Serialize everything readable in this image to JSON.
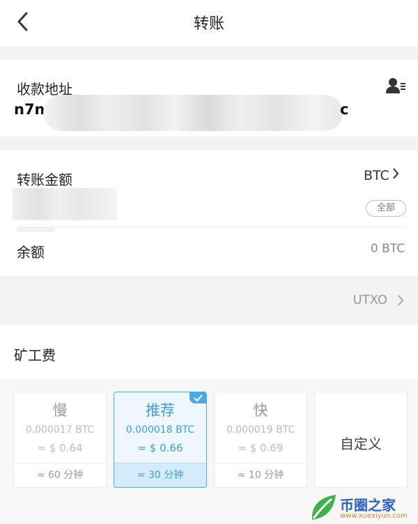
{
  "header": {
    "title": "转账",
    "back_icon": "chevron-left-icon"
  },
  "address": {
    "label": "收款地址",
    "start": "n7na",
    "end": "c",
    "contact_icon": "contact-book-icon"
  },
  "amount": {
    "label": "转账金额",
    "coin": "BTC",
    "all_label": "全部"
  },
  "balance": {
    "label": "余额",
    "value": "0 BTC"
  },
  "utxo": {
    "label": "UTXO"
  },
  "fee": {
    "label": "矿工费",
    "options": [
      {
        "speed": "慢",
        "fee": "0.000017 BTC",
        "usd": "≈ $ 0.64",
        "time": "≈ 60 分钟",
        "selected": false
      },
      {
        "speed": "推荐",
        "fee": "0.000018 BTC",
        "usd": "≈ $ 0.66",
        "time": "≈ 30 分钟",
        "selected": true
      },
      {
        "speed": "快",
        "fee": "0.000019 BTC",
        "usd": "≈ $ 0.69",
        "time": "≈ 10 分钟",
        "selected": false
      }
    ],
    "custom_label": "自定义"
  },
  "watermark": {
    "text": "币圈之家",
    "url": "www.xuexiyun.com"
  },
  "colors": {
    "accent": "#4aa8e8",
    "band": "#f3f3f3"
  }
}
